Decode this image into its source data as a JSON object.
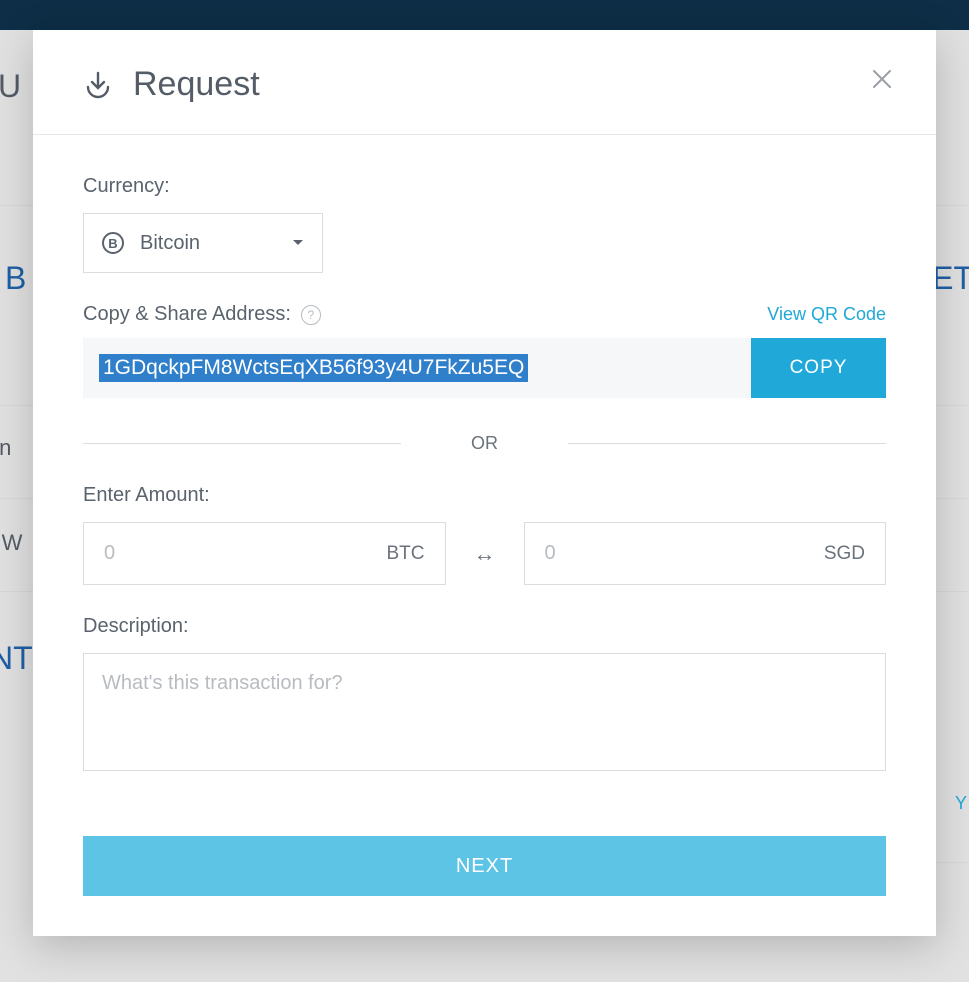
{
  "background": {
    "left_letters": [
      "U",
      "B",
      "oin",
      "er W",
      "NT",
      "ET"
    ],
    "right_letter_y": "Y"
  },
  "modal": {
    "title": "Request",
    "close_label": "Close",
    "currency": {
      "label": "Currency:",
      "selected": "Bitcoin",
      "symbol": "B"
    },
    "address": {
      "label": "Copy & Share Address:",
      "value": "1GDqckpFM8WctsEqXB56f93y4U7FkZu5EQ",
      "qr_link": "View QR Code",
      "copy_button": "COPY"
    },
    "divider": "OR",
    "amount": {
      "label": "Enter Amount:",
      "left_placeholder": "0",
      "left_unit": "BTC",
      "right_placeholder": "0",
      "right_unit": "SGD"
    },
    "description": {
      "label": "Description:",
      "placeholder": "What's this transaction for?"
    },
    "next_button": "NEXT"
  }
}
